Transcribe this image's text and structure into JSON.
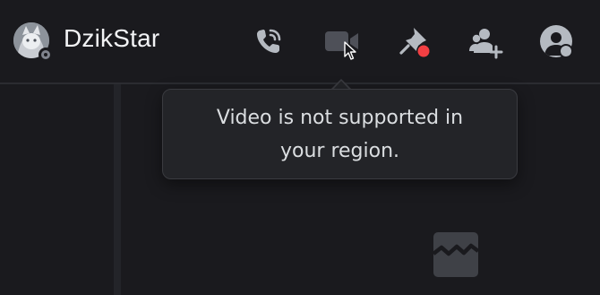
{
  "header": {
    "username": "DzikStar",
    "avatar": {
      "icon": "user-avatar",
      "status": "offline"
    },
    "buttons": [
      {
        "id": "voice-call",
        "icon": "phone-call-icon",
        "color": "#b5bac1"
      },
      {
        "id": "video-call",
        "icon": "video-camera-icon",
        "color": "#4e5058",
        "state": "disabled"
      },
      {
        "id": "pinned-messages",
        "icon": "pin-icon",
        "color": "#b5bac1",
        "badge_color": "#f23f43"
      },
      {
        "id": "add-friends",
        "icon": "add-user-icon",
        "color": "#b5bac1"
      },
      {
        "id": "user-profile",
        "icon": "user-profile-icon",
        "color": "#b5bac1"
      }
    ]
  },
  "tooltip": {
    "text": "Video is not supported in your region."
  },
  "main": {
    "placeholder_icon": "broken-image-icon"
  },
  "colors": {
    "background": "#1a1a1e",
    "header_border": "#2b2c31",
    "tooltip_bg": "#232428",
    "tooltip_border": "#3a3b40",
    "text_primary": "#f2f3f5",
    "icon_default": "#b5bac1",
    "icon_disabled": "#4e5058",
    "badge_red": "#f23f43"
  }
}
